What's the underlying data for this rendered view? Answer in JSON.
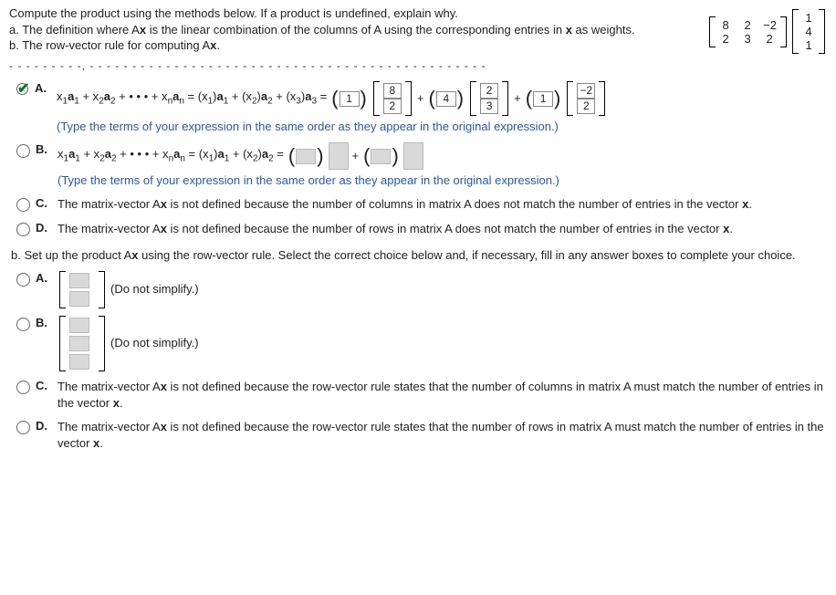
{
  "stem": {
    "line1": "Compute the product using the methods below. If a product is undefined, explain why.",
    "lineA": "a. The definition where Ax is the linear combination of the columns of A using the corresponding entries in x as weights.",
    "lineB": "b. The row-vector rule for computing Ax."
  },
  "matrixA": [
    [
      "8",
      "2",
      "−2"
    ],
    [
      "2",
      "3",
      "2"
    ]
  ],
  "vectorX": [
    "1",
    "4",
    "1"
  ],
  "cutline": "- - - - - - - - -, - - - - - - - - - - - - - - - - - - - - - - - - - - - - - - - - - - - - - - - - - - - - - - -",
  "partA": {
    "A": {
      "lead": "x₁a₁ + x₂a₂ + • • • + xₙaₙ = (x₁)a₁ + (x₂)a₂ + (x₃)a₃ =",
      "scalar1": "1",
      "col1": [
        "8",
        "2"
      ],
      "scalar2": "4",
      "col2": [
        "2",
        "3"
      ],
      "scalar3": "1",
      "col3": [
        "−2",
        "2"
      ],
      "plus": "+",
      "hint": "(Type the terms of your expression in the same order as they appear in the original expression.)"
    },
    "B": {
      "lead": "x₁a₁ + x₂a₂ + • • • + xₙaₙ = (x₁)a₁ + (x₂)a₂ =",
      "hint": "(Type the terms of your expression in the same order as they appear in the original expression.)"
    },
    "C": "The matrix-vector Ax is not defined because the number of columns in matrix A does not match the number of entries in the vector x.",
    "D": "The matrix-vector Ax is not defined because the number of rows in matrix A does not match the number of entries in the vector x."
  },
  "partB_title": "b. Set up the product Ax using the row-vector rule. Select the correct choice below and, if necessary, fill in any answer boxes to complete your choice.",
  "partB": {
    "A": {
      "after": "(Do not simplify.)"
    },
    "B": {
      "after": "(Do not simplify.)"
    },
    "C": "The matrix-vector Ax is not defined because the row-vector rule states that the number of columns in matrix A must match the number of entries in the vector x.",
    "D": "The matrix-vector Ax is not defined because the row-vector rule states that the number of rows in matrix A must match the number of entries in the vector x."
  },
  "labels": {
    "A": "A.",
    "B": "B.",
    "C": "C.",
    "D": "D."
  }
}
